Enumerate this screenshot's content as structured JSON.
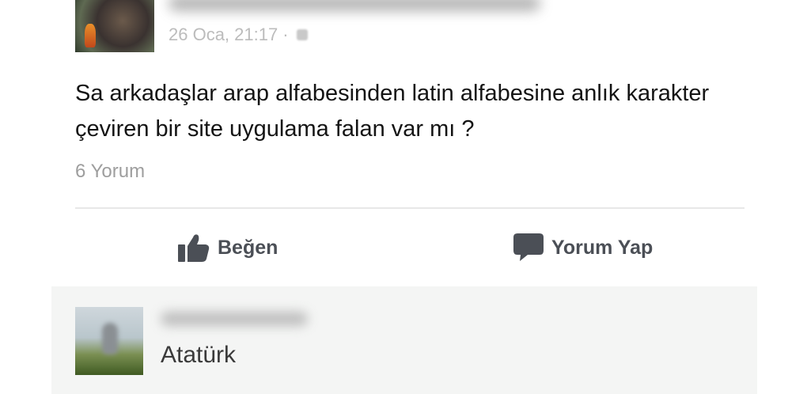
{
  "post": {
    "timestamp": "26 Oca, 21:17",
    "separator": "·",
    "text": "Sa arkadaşlar arap alfabesinden latin alfabesine anlık karakter çeviren bir site uygulama falan var mı ?",
    "comment_count": "6 Yorum"
  },
  "actions": {
    "like_label": "Beğen",
    "comment_label": "Yorum Yap",
    "icon_color": "#4b4f56"
  },
  "comments": [
    {
      "text": "Atatürk"
    }
  ],
  "icons": [
    "globe-icon",
    "thumbs-up-icon",
    "speech-bubble-icon"
  ]
}
